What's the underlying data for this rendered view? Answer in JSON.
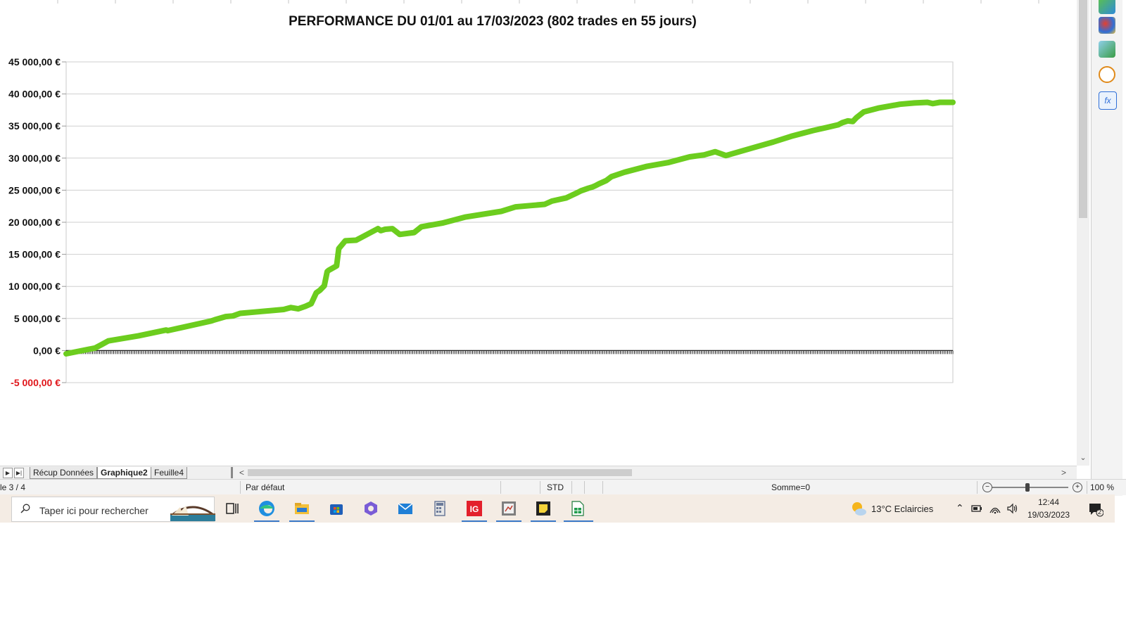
{
  "chart_data": {
    "type": "line",
    "title": "PERFORMANCE  DU 01/01 au 17/03/2023 (802 trades en 55 jours)",
    "ylim": [
      -5000,
      45000
    ],
    "y_ticks": [
      -5000,
      0,
      5000,
      10000,
      15000,
      20000,
      25000,
      30000,
      35000,
      40000,
      45000
    ],
    "y_tick_labels": [
      "-5 000,00 €",
      "0,00 €",
      "5 000,00 €",
      "10 000,00 €",
      "15 000,00 €",
      "20 000,00 €",
      "25 000,00 €",
      "30 000,00 €",
      "35 000,00 €",
      "40 000,00 €",
      "45 000,00 €"
    ],
    "negative_label_color": "#e0161b",
    "line_color": "#6ccd1e",
    "grid": true,
    "series": [
      {
        "x": [
          0,
          40,
          50,
          58,
          100,
          138,
          140,
          200,
          205,
          220,
          230,
          240,
          260,
          300,
          310,
          320,
          330,
          338,
          345,
          350,
          356,
          360,
          362,
          373,
          376,
          385,
          400,
          430,
          434,
          440,
          450,
          460,
          480,
          490,
          520,
          550,
          600,
          620,
          640,
          660,
          670,
          690,
          705,
          710,
          720,
          726,
          730,
          735,
          745,
          752,
          770,
          800,
          830,
          860,
          880,
          895,
          910,
          950,
          975,
          1000,
          1030,
          1050,
          1065,
          1070,
          1078,
          1085,
          1090,
          1100,
          1120,
          1150,
          1170,
          1188,
          1195,
          1205,
          1223
        ],
        "y": [
          -500,
          400,
          1000,
          1500,
          2300,
          3200,
          3100,
          4600,
          4800,
          5300,
          5400,
          5800,
          6000,
          6400,
          6700,
          6500,
          6900,
          7300,
          9000,
          9400,
          10100,
          12300,
          12500,
          13200,
          15900,
          17100,
          17200,
          19000,
          18700,
          18900,
          19000,
          18100,
          18400,
          19300,
          19900,
          20800,
          21700,
          22400,
          22600,
          22800,
          23300,
          23800,
          24600,
          24900,
          25300,
          25500,
          25700,
          26000,
          26500,
          27100,
          27800,
          28700,
          29300,
          30200,
          30500,
          31000,
          30400,
          31700,
          32500,
          33400,
          34300,
          34800,
          35200,
          35500,
          35800,
          35700,
          36300,
          37200,
          37800,
          38400,
          38600,
          38700,
          38500,
          38700,
          38700
        ]
      }
    ]
  },
  "tabbar": {
    "tabs": [
      "Récup Données",
      "Graphique2",
      "Feuille4"
    ],
    "active_tab": "Graphique2"
  },
  "statusbar": {
    "sheet": "le 3 / 4",
    "page_style": "Par défaut",
    "mode": "STD",
    "sum": "Somme=0",
    "zoom": "100 %"
  },
  "taskbar": {
    "search_placeholder": "Taper ici pour rechercher",
    "weather": "13°C  Eclaircies",
    "time": "12:44",
    "date": "19/03/2023",
    "notifications": "2"
  }
}
